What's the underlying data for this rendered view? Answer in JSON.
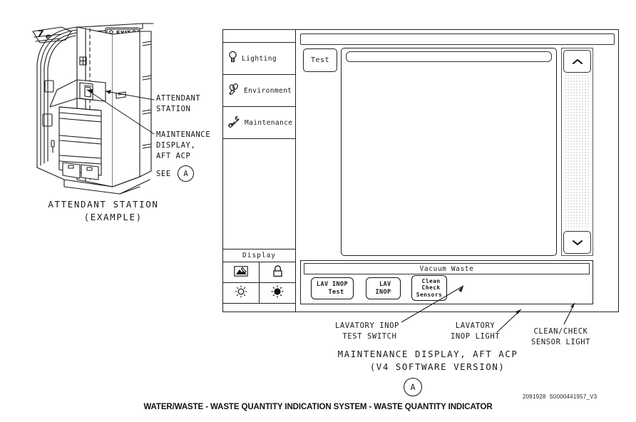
{
  "illustration": {
    "exit_sign_label": "EXIT",
    "callouts": [
      {
        "name": "attendant-station",
        "text": "ATTENDANT\nSTATION"
      },
      {
        "name": "maintenance-display",
        "text": "MAINTENANCE\nDISPLAY,\nAFT ACP"
      }
    ],
    "see_label": "SEE",
    "see_reference": "A",
    "caption": "ATTENDANT STATION\n   (EXAMPLE)"
  },
  "panel": {
    "sidebar": {
      "items": [
        {
          "label": "Lighting",
          "icon": "light-bulb-icon"
        },
        {
          "label": "Environment",
          "icon": "fan-icon"
        },
        {
          "label": "Maintenance",
          "icon": "wrench-icon"
        }
      ],
      "display_section": {
        "title": "Display",
        "buttons": [
          {
            "icon": "screen-calibrate-icon"
          },
          {
            "icon": "lock-icon"
          },
          {
            "icon": "brightness-low-icon"
          },
          {
            "icon": "brightness-high-icon"
          }
        ]
      }
    },
    "content": {
      "test_button_label": "Test",
      "scroll_up_icon": "chevron-up-icon",
      "scroll_down_icon": "chevron-down-icon"
    },
    "vacuum_waste": {
      "title": "Vacuum Waste",
      "buttons": [
        {
          "name": "lav-inop-test",
          "label": "LAV INOP\n  Test"
        },
        {
          "name": "lav-inop",
          "label": " LAV\nINOP"
        },
        {
          "name": "clean-check",
          "label": " Clean\n Check\nSensors"
        }
      ]
    }
  },
  "lower_callouts": [
    {
      "name": "lavatory-inop-test-switch",
      "text": "LAVATORY INOP\n TEST SWITCH"
    },
    {
      "name": "lavatory-inop-light",
      "text": "LAVATORY\nINOP LIGHT"
    },
    {
      "name": "clean-check-sensor-light",
      "text": "CLEAN/CHECK\nSENSOR LIGHT"
    }
  ],
  "figure": {
    "main_caption": "MAINTENANCE DISPLAY, AFT ACP\n   (V4 SOFTWARE VERSION)",
    "reference_letter": "A",
    "document_number": "2091928  S0000441957_V3",
    "bottom_title": "WATER/WASTE - WASTE QUANTITY INDICATION SYSTEM - WASTE QUANTITY INDICATOR"
  },
  "colors": {
    "line": "#1a1a1a",
    "background": "#ffffff"
  }
}
